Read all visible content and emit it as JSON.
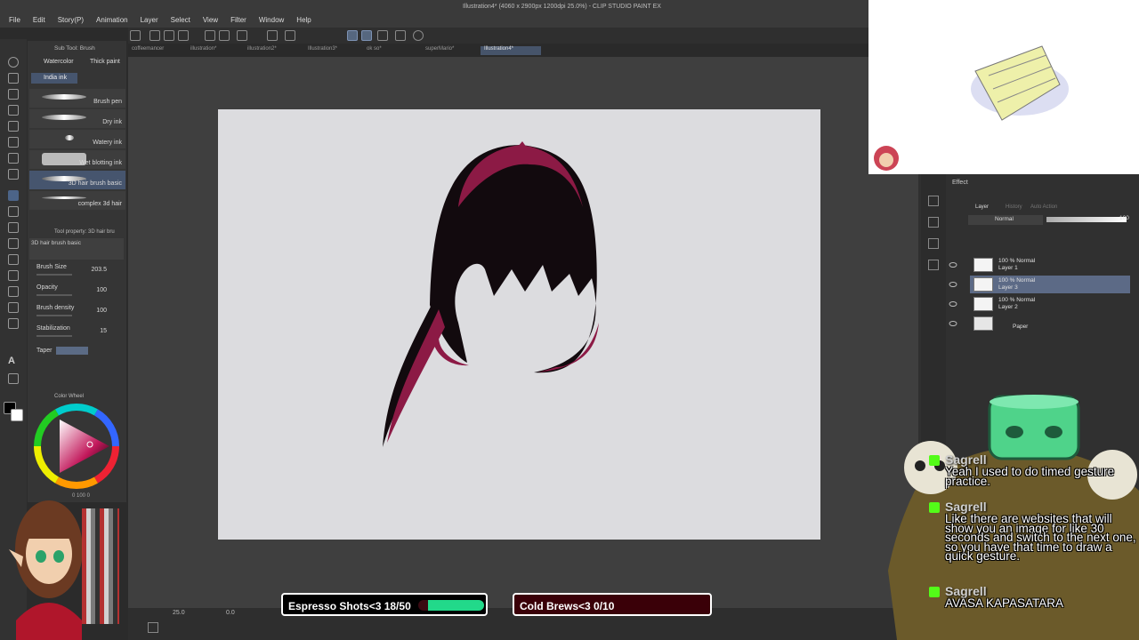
{
  "window": {
    "title": "Illustration4* (4060 x 2900px 1200dpi 25.0%) - CLIP STUDIO PAINT EX"
  },
  "menu": [
    "File",
    "Edit",
    "Story(P)",
    "Animation",
    "Layer",
    "Select",
    "View",
    "Filter",
    "Window",
    "Help"
  ],
  "tabs": [
    "coffeemancer",
    "illustration*",
    "illustration2*",
    "Illustration3*",
    "ok so*",
    "superMario*",
    "Illustration4*"
  ],
  "subtool": {
    "header": "Sub Tool: Brush",
    "groups": [
      "Watercolor",
      "Thick paint",
      "India ink"
    ],
    "brushes": [
      "Brush pen",
      "Dry ink",
      "Watery ink",
      "Wet blotting ink",
      "3D hair brush basic",
      "complex 3d hair"
    ]
  },
  "toolprop": {
    "header": "Tool property: 3D hair bru",
    "brush_name": "3D hair brush basic",
    "props": [
      {
        "label": "Brush Size",
        "value": "203.5"
      },
      {
        "label": "Opacity",
        "value": "100"
      },
      {
        "label": "Brush density",
        "value": "100"
      },
      {
        "label": "Stabilization",
        "value": "15"
      },
      {
        "label": "Taper",
        "value": ""
      }
    ]
  },
  "colorwheel": {
    "header": "Color Wheel",
    "readout": "0 100 0"
  },
  "layers": {
    "panel_tabs": [
      "Layer",
      "History",
      "Auto Action"
    ],
    "effect_label": "Effect",
    "blend_mode": "Normal",
    "opacity": "100",
    "items": [
      {
        "line1": "100 % Normal",
        "line2": "Layer 1"
      },
      {
        "line1": "100 % Normal",
        "line2": "Layer 3"
      },
      {
        "line1": "100 % Normal",
        "line2": "Layer 2"
      },
      {
        "line1": "",
        "line2": "Paper"
      }
    ]
  },
  "chat": [
    {
      "user": "Sagrell",
      "message": "Yeah I used to do timed gesture practice."
    },
    {
      "user": "Sagrell",
      "message": "Like there are websites that will show you an image for like 30 seconds and switch to the next one, so you have that time to draw a quick gesture."
    },
    {
      "user": "Sagrell",
      "message": "AVASA KAPASATARA"
    }
  ],
  "goals": [
    {
      "label": "Espresso Shots<3 18/50",
      "current": 18,
      "target": 50,
      "color": "#22d98a"
    },
    {
      "label": "Cold Brews<3 0/10",
      "current": 0,
      "target": 10,
      "color": "#c2183e"
    }
  ],
  "statusbar": {
    "zoom": "25.0",
    "angle": "0.0"
  },
  "colors": {
    "hair_dark": "#120a0e",
    "hair_accent": "#8c1a45",
    "accent": "#4c6488"
  }
}
